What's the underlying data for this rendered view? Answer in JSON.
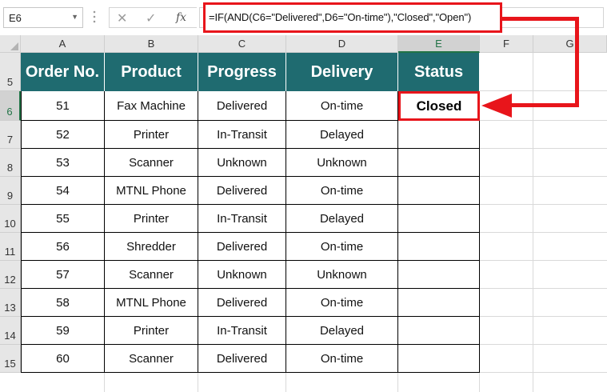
{
  "formula_bar": {
    "name_box": "E6",
    "cancel_icon": "close-icon",
    "enter_icon": "check-icon",
    "function_icon": "fx",
    "formula": "=IF(AND(C6=\"Delivered\",D6=\"On-time\"),\"Closed\",\"Open\")"
  },
  "columns": [
    "A",
    "B",
    "C",
    "D",
    "E",
    "F",
    "G"
  ],
  "rows": [
    "5",
    "6",
    "7",
    "8",
    "9",
    "10",
    "11",
    "12",
    "13",
    "14",
    "15"
  ],
  "selected_cell": "E6",
  "table": {
    "headers": [
      "Order No.",
      "Product",
      "Progress",
      "Delivery",
      "Status"
    ],
    "rows": [
      [
        "51",
        "Fax Machine",
        "Delivered",
        "On-time",
        "Closed"
      ],
      [
        "52",
        "Printer",
        "In-Transit",
        "Delayed",
        ""
      ],
      [
        "53",
        "Scanner",
        "Unknown",
        "Unknown",
        ""
      ],
      [
        "54",
        "MTNL Phone",
        "Delivered",
        "On-time",
        ""
      ],
      [
        "55",
        "Printer",
        "In-Transit",
        "Delayed",
        ""
      ],
      [
        "56",
        "Shredder",
        "Delivered",
        "On-time",
        ""
      ],
      [
        "57",
        "Scanner",
        "Unknown",
        "Unknown",
        ""
      ],
      [
        "58",
        "MTNL Phone",
        "Delivered",
        "On-time",
        ""
      ],
      [
        "59",
        "Printer",
        "In-Transit",
        "Delayed",
        ""
      ],
      [
        "60",
        "Scanner",
        "Delivered",
        "On-time",
        ""
      ]
    ]
  },
  "colors": {
    "header_fill": "#1f6b70",
    "highlight": "#e8151b",
    "selection": "#217346"
  }
}
